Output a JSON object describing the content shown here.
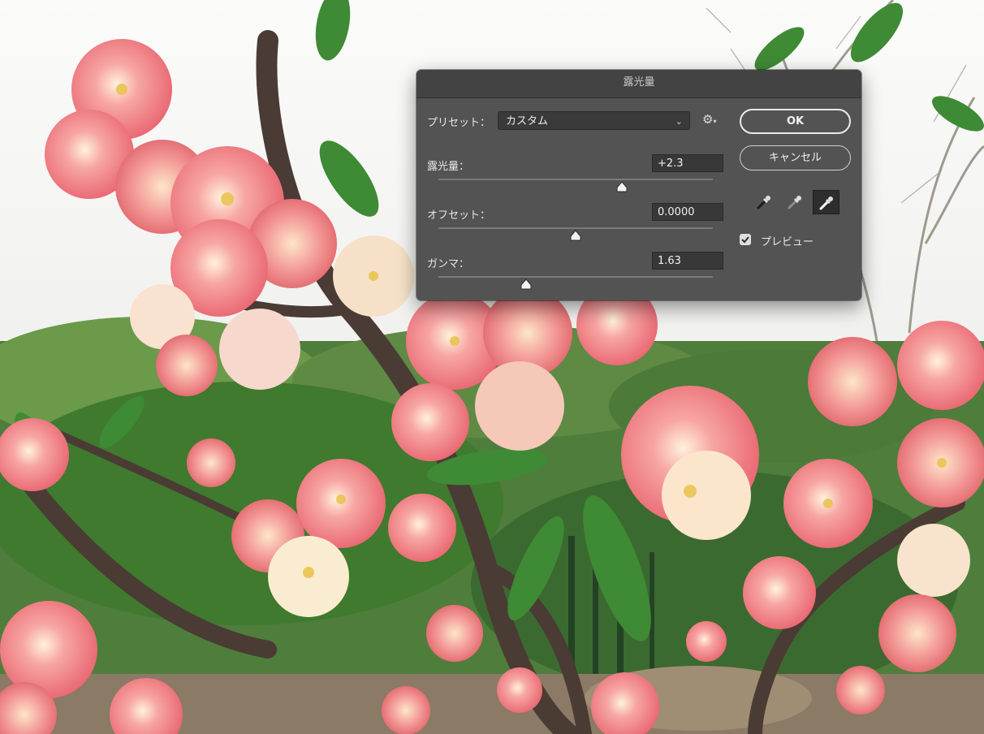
{
  "dialog": {
    "title": "露光量",
    "preset_label": "プリセット：",
    "preset_value": "カスタム",
    "exposure_label": "露光量：",
    "exposure_value": "+2.3",
    "exposure_level": 0.67,
    "offset_label": "オフセット：",
    "offset_value": "0.0000",
    "offset_level": 0.5,
    "gamma_label": "ガンマ：",
    "gamma_value": "1.63",
    "gamma_level": 0.32,
    "ok_label": "OK",
    "cancel_label": "キャンセル",
    "preview_label": "プレビュー",
    "preview_checked": true
  },
  "icons": [
    "gear-icon",
    "black-point-eyedropper-icon",
    "gray-point-eyedropper-icon",
    "white-point-eyedropper-icon",
    "chevron-down-icon",
    "checkmark-icon"
  ]
}
